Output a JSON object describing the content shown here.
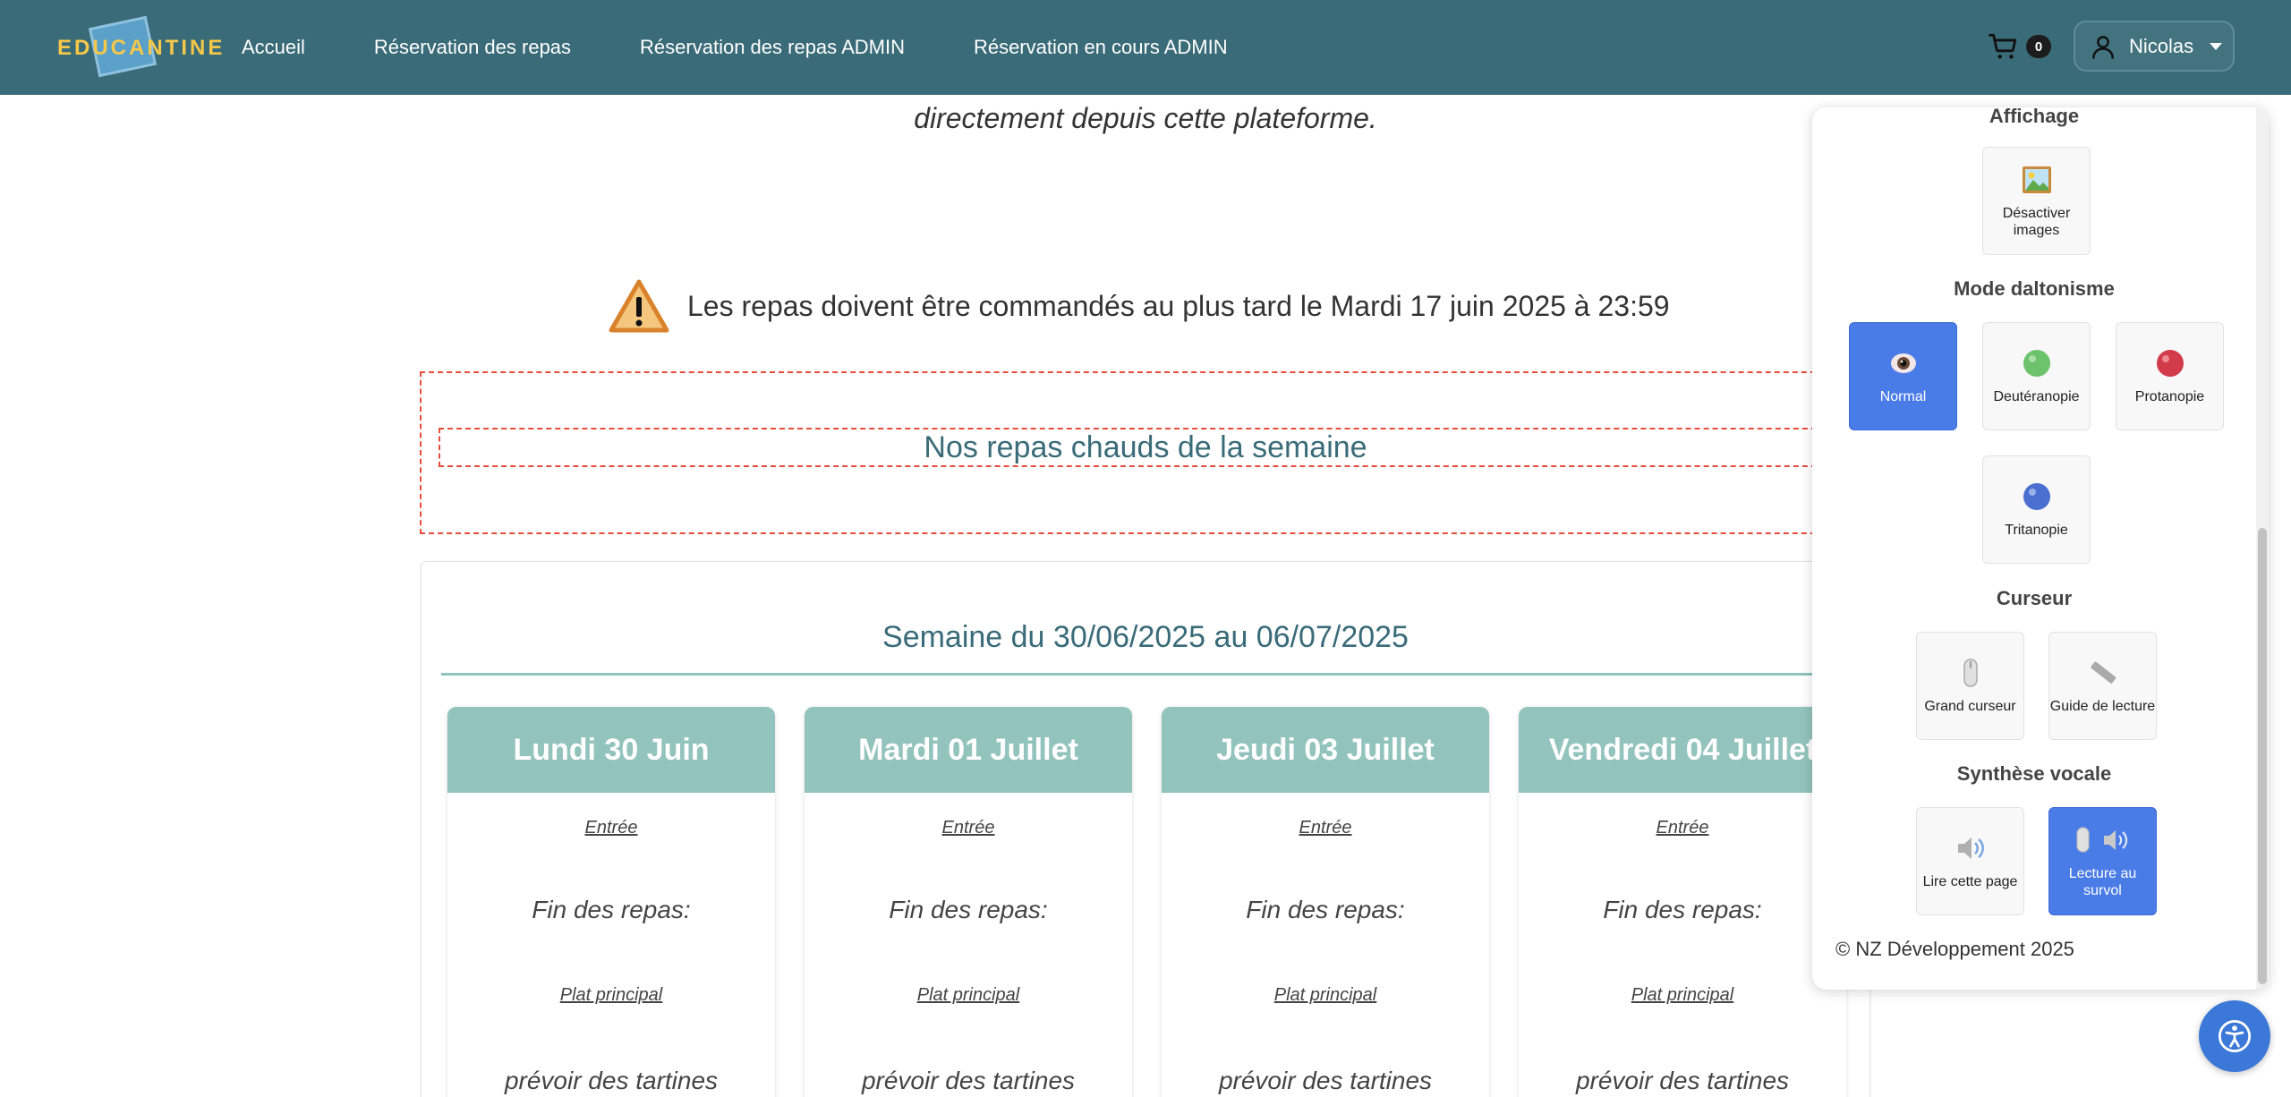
{
  "nav": {
    "logo_text": "EDUCANTINE",
    "links": [
      "Accueil",
      "Réservation des repas",
      "Réservation des repas ADMIN",
      "Réservation en cours ADMIN"
    ],
    "cart_count": "0",
    "user_name": "Nicolas"
  },
  "main": {
    "intro": "directement depuis cette plateforme.",
    "warning": "Les repas doivent être commandés au plus tard le Mardi 17 juin 2025 à 23:59",
    "hot_title": "Nos repas chauds de la semaine",
    "week_title": "Semaine du 30/06/2025 au 06/07/2025",
    "days": [
      {
        "name": "Lundi 30 Juin",
        "entree": "Entrée",
        "fin": "Fin des repas:",
        "plat": "Plat principal",
        "plat_text": "prévoir des tartines"
      },
      {
        "name": "Mardi 01 Juillet",
        "entree": "Entrée",
        "fin": "Fin des repas:",
        "plat": "Plat principal",
        "plat_text": "prévoir des tartines"
      },
      {
        "name": "Jeudi 03 Juillet",
        "entree": "Entrée",
        "fin": "Fin des repas:",
        "plat": "Plat principal",
        "plat_text": "prévoir des tartines"
      },
      {
        "name": "Vendredi 04 Juillet",
        "entree": "Entrée",
        "fin": "Fin des repas:",
        "plat": "Plat principal",
        "plat_text": "prévoir des tartines"
      }
    ]
  },
  "a11y": {
    "display_title": "Affichage",
    "disable_images": "Désactiver images",
    "color_title": "Mode daltonisme",
    "color_modes": [
      {
        "label": "Normal",
        "active": true
      },
      {
        "label": "Deutéranopie",
        "active": false
      },
      {
        "label": "Protanopie",
        "active": false
      },
      {
        "label": "Tritanopie",
        "active": false
      }
    ],
    "cursor_title": "Curseur",
    "big_cursor": "Grand curseur",
    "reading_guide": "Guide de lecture",
    "tts_title": "Synthèse vocale",
    "read_page": "Lire cette page",
    "hover_read": "Lecture au survol",
    "copyright": "© NZ Développement 2025"
  },
  "colors": {
    "navbar": "#3a6b78",
    "accent": "#4a7ce8",
    "day_header": "#93c3bd",
    "dashed": "#e74c3c"
  }
}
